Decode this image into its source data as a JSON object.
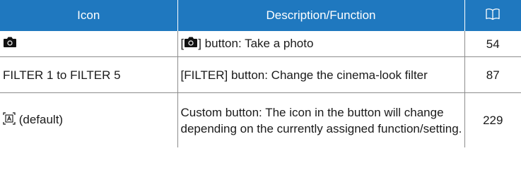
{
  "table": {
    "headers": {
      "icon": "Icon",
      "description": "Description/Function",
      "page_icon": "book-icon"
    },
    "rows": [
      {
        "icon_text": "",
        "icon_name": "camera-icon",
        "desc_prefix": "[",
        "desc_icon": "camera-icon",
        "desc_suffix": "] button: Take a photo",
        "page": "54"
      },
      {
        "icon_text": "FILTER 1 to FILTER 5",
        "desc": "[FILTER] button: Change the cinema-look filter",
        "page": "87"
      },
      {
        "icon_name": "custom-button-icon",
        "icon_text": " (default)",
        "desc": "Custom button: The icon in the button will change depending on the currently assigned function/setting.",
        "page": "229"
      }
    ]
  }
}
